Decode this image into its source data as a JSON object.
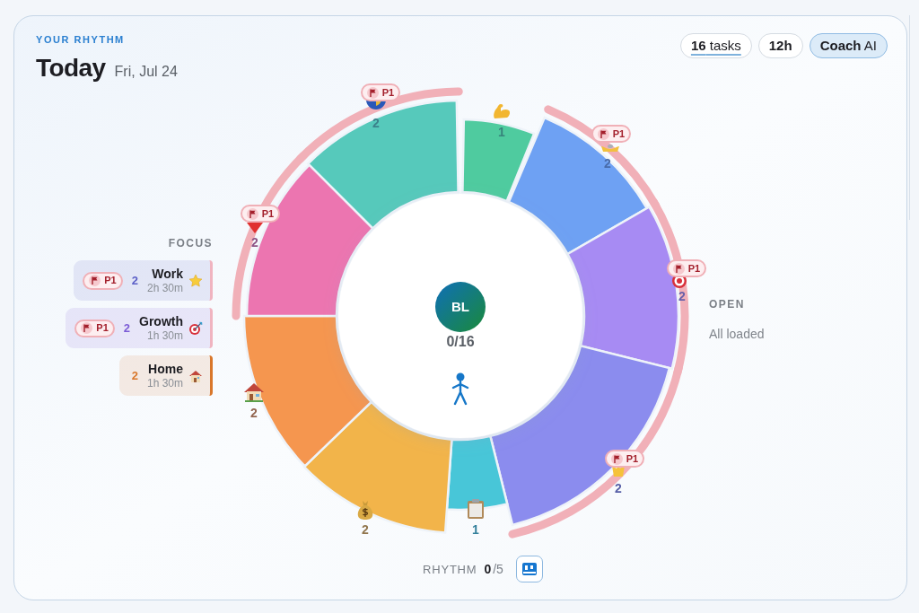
{
  "header": {
    "eyebrow": "YOUR RHYTHM",
    "title": "Today",
    "date": "Fri, Jul 24"
  },
  "chips": [
    {
      "text": "**16** tasks",
      "underlined": true,
      "selected": false
    },
    {
      "text": "**12h**",
      "underlined": false,
      "selected": false
    },
    {
      "text": "**Coach** AI",
      "underlined": false,
      "selected": true
    }
  ],
  "focus": {
    "title": "FOCUS",
    "items": [
      {
        "badge": "P1",
        "count": "2",
        "name": "Work",
        "duration": "2h 30m",
        "color": "#5b5fc7"
      },
      {
        "badge": "P1",
        "count": "2",
        "name": "Growth",
        "duration": "1h 30m",
        "color": "#7c5cd6"
      },
      {
        "count": "2",
        "name": "Home",
        "duration": "1h 30m",
        "color": "#d9772b"
      }
    ]
  },
  "ring": {
    "avatar": "BL",
    "progress": "0/16",
    "segments": [
      {
        "count": "1",
        "color": "#4fcb9f"
      },
      {
        "count": "2",
        "color": "#6ea1f3",
        "badge": "P1"
      },
      {
        "count": "2",
        "color": "#a78bf3",
        "badge": "P1"
      },
      {
        "count": "2",
        "color": "#8b8cee",
        "badge": "P1"
      },
      {
        "count": "1",
        "color": "#48c6d8"
      },
      {
        "count": "2",
        "color": "#f2b44a"
      },
      {
        "count": "2",
        "color": "#f5964f"
      },
      {
        "count": "2",
        "color": "#ec75b0",
        "badge": "P1"
      },
      {
        "count": "2",
        "color": "#56c9bb",
        "badge": "P1"
      }
    ]
  },
  "open": {
    "title": "OPEN",
    "status": "All loaded"
  },
  "rhythm": {
    "label": "RHYTHM",
    "done": "0",
    "total": "/5"
  }
}
